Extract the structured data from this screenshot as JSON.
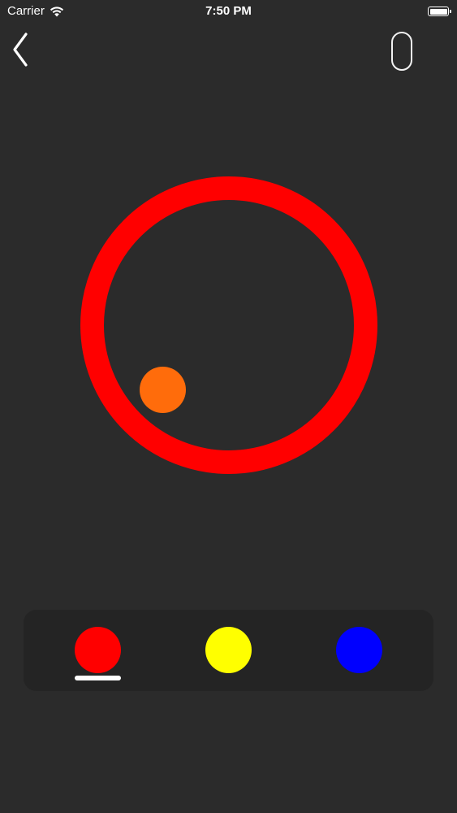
{
  "status_bar": {
    "carrier": "Carrier",
    "time": "7:50 PM",
    "icons": [
      "wifi-icon",
      "battery-icon"
    ]
  },
  "controls": {
    "back_icon": "chevron-left-icon",
    "pause_icon": "pill-outline-icon"
  },
  "game": {
    "ring_color": "#ff0000",
    "ball_color": "#ff6c0b"
  },
  "color_selector": {
    "swatches": [
      {
        "name": "red",
        "color": "#ff0000",
        "selected": true
      },
      {
        "name": "yellow",
        "color": "#ffff00",
        "selected": false
      },
      {
        "name": "blue",
        "color": "#0000ff",
        "selected": false
      }
    ]
  },
  "colors": {
    "background": "#2b2b2b",
    "panel": "#242424",
    "foreground": "#ffffff"
  }
}
